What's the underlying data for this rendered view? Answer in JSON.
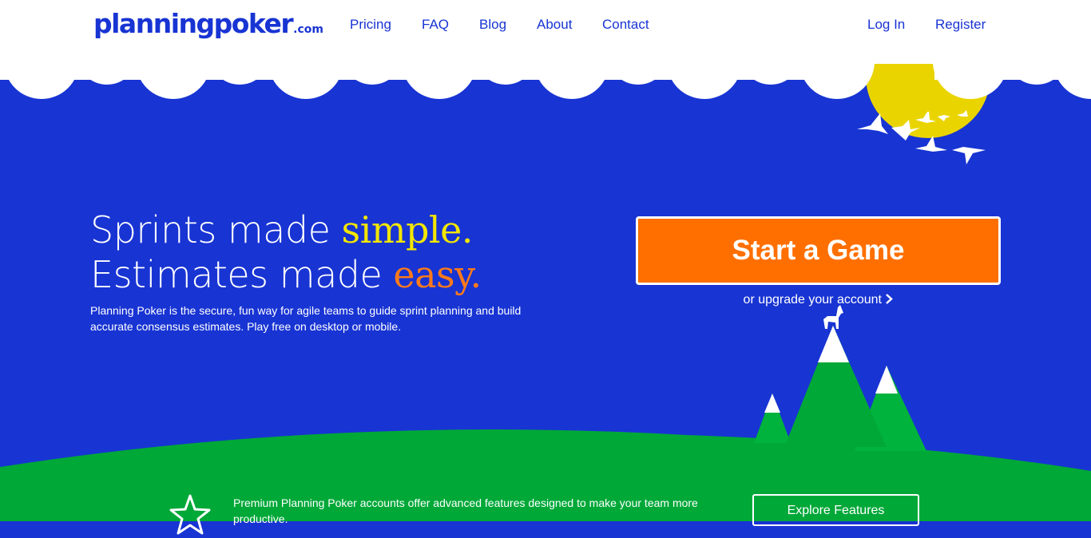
{
  "header": {
    "logo_main": "planningpoker",
    "logo_suffix": ".com",
    "nav": [
      "Pricing",
      "FAQ",
      "Blog",
      "About",
      "Contact"
    ],
    "login": "Log In",
    "register": "Register"
  },
  "hero": {
    "line1_prefix": "Sprints made ",
    "line1_accent": "simple.",
    "line2_prefix": "Estimates made ",
    "line2_accent": "easy.",
    "subtitle": "Planning Poker is the secure, fun way for agile teams to guide sprint planning and build accurate consensus estimates. Play free on desktop or mobile.",
    "cta": "Start a Game",
    "upgrade_link": "or upgrade your account"
  },
  "promo": {
    "text": "Premium Planning Poker accounts offer advanced features designed to make your team more productive.",
    "button": "Explore Features"
  },
  "colors": {
    "brand_blue": "#1834d3",
    "cta_orange": "#ff6f00",
    "grass_green": "#00a838",
    "accent_yellow": "#f2e600",
    "accent_orange": "#ff7a1a"
  },
  "icons": [
    "chevron-right-icon",
    "star-icon",
    "sun-icon",
    "birds-icon",
    "goat-icon",
    "mountain-icon",
    "cloud-icon"
  ]
}
